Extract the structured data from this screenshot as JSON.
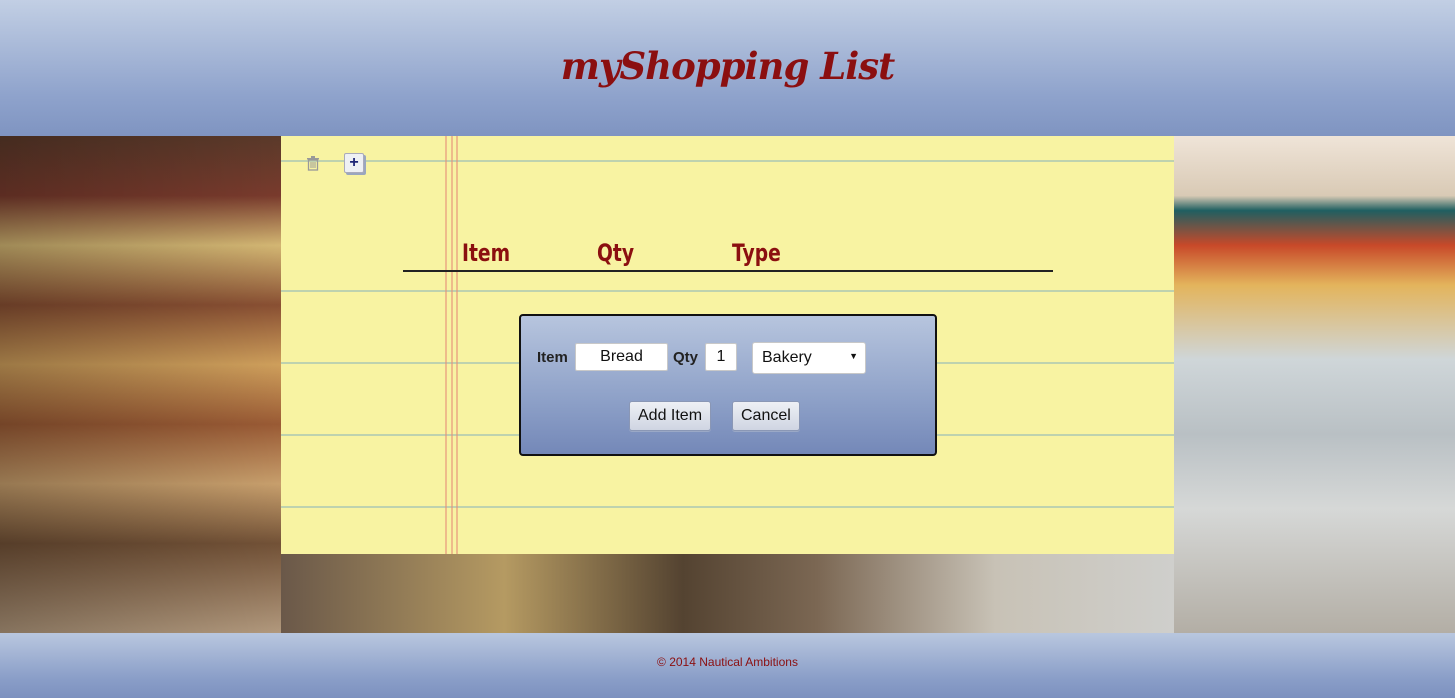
{
  "header": {
    "title": "myShopping List"
  },
  "toolbar": {
    "delete_icon": "trash-icon",
    "add_icon": "plus-icon"
  },
  "list": {
    "columns": [
      "Item",
      "Qty",
      "Type"
    ]
  },
  "dialog": {
    "item_label": "Item",
    "item_value": "Bread",
    "qty_label": "Qty",
    "qty_value": "1",
    "type_value": "Bakery",
    "add_button": "Add Item",
    "cancel_button": "Cancel"
  },
  "footer": {
    "copyright": "© 2014 Nautical Ambitions"
  },
  "colors": {
    "accent": "#8b0f10",
    "paper": "#f8f3a2",
    "header": "#8fa3cc"
  }
}
